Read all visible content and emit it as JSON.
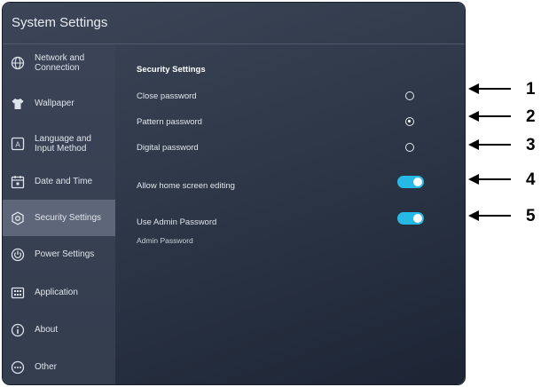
{
  "window": {
    "title": "System Settings"
  },
  "sidebar": {
    "items": [
      {
        "label": "Network and\nConnection",
        "icon": "globe-icon",
        "active": false
      },
      {
        "label": "Wallpaper",
        "icon": "shirt-icon",
        "active": false
      },
      {
        "label": "Language and\nInput Method",
        "icon": "keyboard-a-icon",
        "active": false
      },
      {
        "label": "Date and Time",
        "icon": "calendar-icon",
        "active": false
      },
      {
        "label": "Security Settings",
        "icon": "shield-gear-icon",
        "active": true
      },
      {
        "label": "Power Settings",
        "icon": "power-icon",
        "active": false
      },
      {
        "label": "Application",
        "icon": "app-grid-icon",
        "active": false
      },
      {
        "label": "About",
        "icon": "info-icon",
        "active": false
      },
      {
        "label": "Other",
        "icon": "more-icon",
        "active": false
      }
    ]
  },
  "security": {
    "section_title": "Security Settings",
    "close_password": "Close password",
    "pattern_password": "Pattern password",
    "digital_password": "Digital password",
    "selected_option": "Pattern password",
    "allow_home_screen_editing": "Allow home screen editing",
    "allow_home_screen_editing_on": true,
    "use_admin_password": "Use Admin Password",
    "use_admin_password_on": true,
    "admin_password_sub": "Admin Password"
  },
  "callouts": [
    "1",
    "2",
    "3",
    "4",
    "5"
  ],
  "colors": {
    "toggle_on": "#27b9e6",
    "sidebar_active": "#5d6779",
    "panel_dark": "#1d2535"
  }
}
